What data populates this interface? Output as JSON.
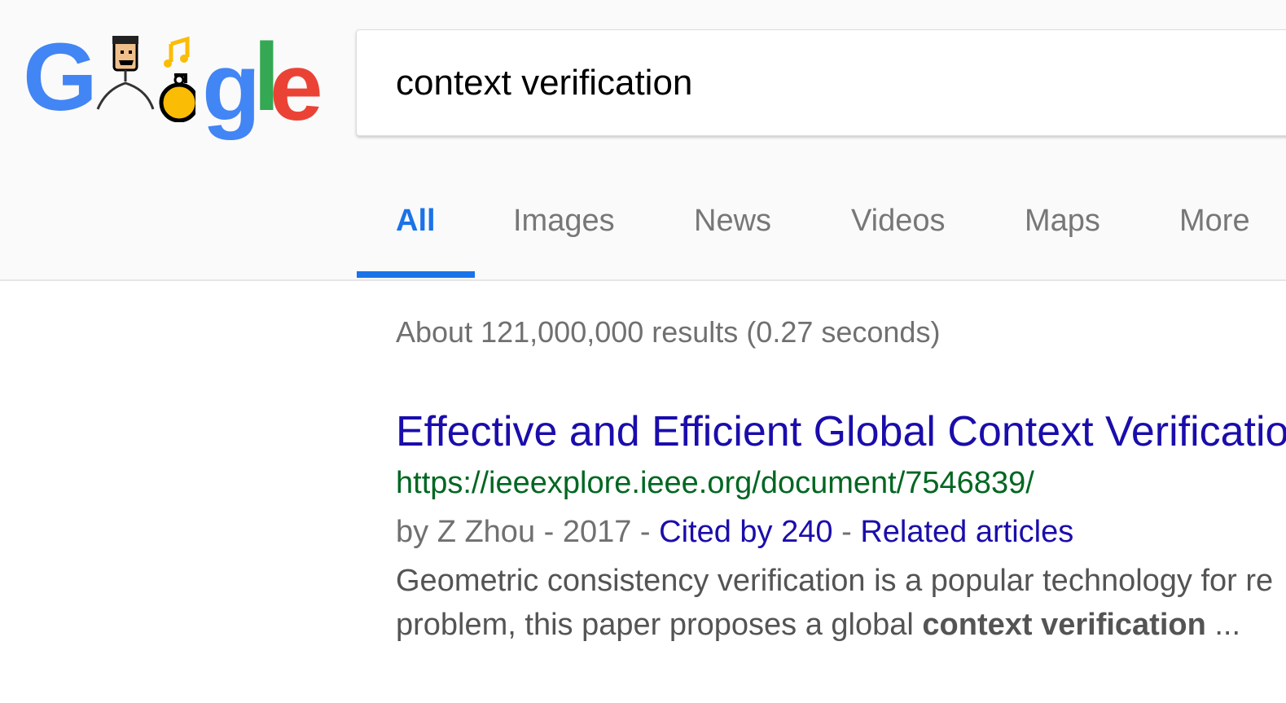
{
  "logo": {
    "letters": [
      "G",
      "g",
      "l",
      "e"
    ],
    "colors": {
      "blue": "#4285f4",
      "red": "#ea4335",
      "green": "#34a853",
      "yellow": "#fbbc05"
    }
  },
  "search": {
    "value": "context verification"
  },
  "tabs": [
    {
      "label": "All",
      "active": true
    },
    {
      "label": "Images",
      "active": false
    },
    {
      "label": "News",
      "active": false
    },
    {
      "label": "Videos",
      "active": false
    },
    {
      "label": "Maps",
      "active": false
    },
    {
      "label": "More",
      "active": false
    }
  ],
  "results_stats": "About 121,000,000 results (0.27 seconds)",
  "result": {
    "title": "Effective and Efficient Global Context Verification",
    "url": "https://ieeexplore.ieee.org/document/7546839/",
    "meta_prefix": "by Z Zhou - 2017 - ",
    "cited_by": "Cited by 240",
    "separator": " - ",
    "related": "Related articles",
    "snippet_line1": "Geometric consistency verification is a popular technology for re",
    "snippet_line2_prefix": "problem, this paper proposes a global ",
    "snippet_line2_bold": "context verification",
    "snippet_line2_suffix": " ..."
  }
}
